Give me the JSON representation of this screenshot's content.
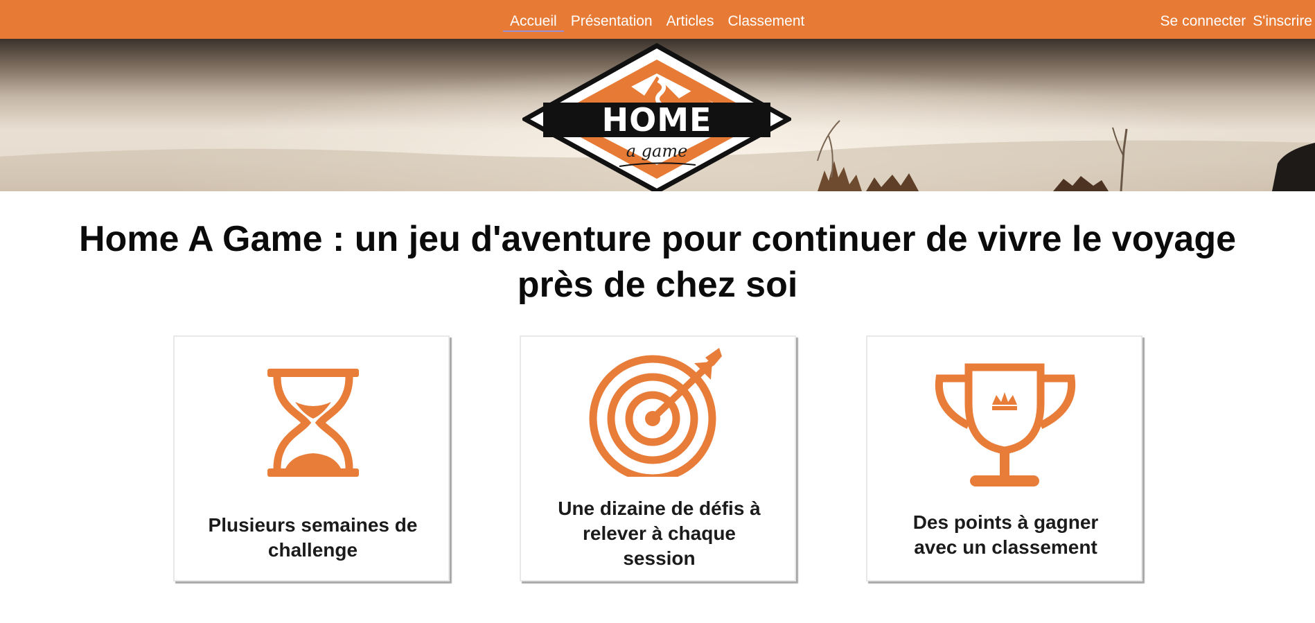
{
  "nav": {
    "links": [
      {
        "label": "Accueil",
        "active": true
      },
      {
        "label": "Présentation",
        "active": false
      },
      {
        "label": "Articles",
        "active": false
      },
      {
        "label": "Classement",
        "active": false
      }
    ],
    "login_label": "Se connecter",
    "signup_label": "S'inscrire"
  },
  "logo": {
    "title": "HOME",
    "subtitle": "a game"
  },
  "headline": {
    "line1": "Home A Game : un jeu d'aventure pour continuer de vivre le voyage",
    "line2": "près de chez soi"
  },
  "features": [
    {
      "icon": "hourglass-icon",
      "text_lines": [
        "Plusieurs semaines de",
        "challenge"
      ]
    },
    {
      "icon": "target-icon",
      "text_lines": [
        "Une dizaine de défis à",
        "relever à chaque",
        "session"
      ]
    },
    {
      "icon": "trophy-icon",
      "text_lines": [
        "Des points à gagner",
        "avec un classement"
      ]
    }
  ],
  "colors": {
    "brand_orange": "#e77b36",
    "icon_orange": "#e87d3a",
    "text_dark": "#0b0b0b",
    "white": "#ffffff"
  }
}
